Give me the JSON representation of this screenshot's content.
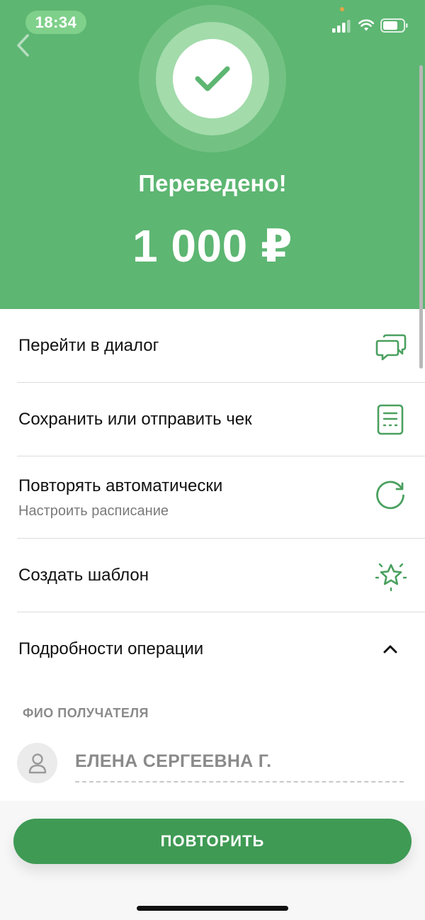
{
  "status_bar": {
    "time": "18:34"
  },
  "header": {
    "title": "Переведено!",
    "amount": "1 000 ₽"
  },
  "actions": [
    {
      "label": "Перейти в диалог",
      "icon": "chat-icon"
    },
    {
      "label": "Сохранить или отправить чек",
      "icon": "receipt-icon"
    },
    {
      "label": "Повторять автоматически",
      "sublabel": "Настроить расписание",
      "icon": "refresh-icon"
    },
    {
      "label": "Создать шаблон",
      "icon": "star-icon"
    },
    {
      "label": "Подробности операции",
      "icon": "chevron-up-icon"
    }
  ],
  "details": {
    "recipient_label": "ФИО ПОЛУЧАТЕЛЯ",
    "recipient_name": "ЕЛЕНА СЕРГЕЕВНА Г."
  },
  "footer": {
    "repeat_label": "ПОВТОРИТЬ"
  },
  "colors": {
    "header_green": "#5db672",
    "accent_green": "#3f9a54",
    "icon_green": "#4aa05f"
  }
}
